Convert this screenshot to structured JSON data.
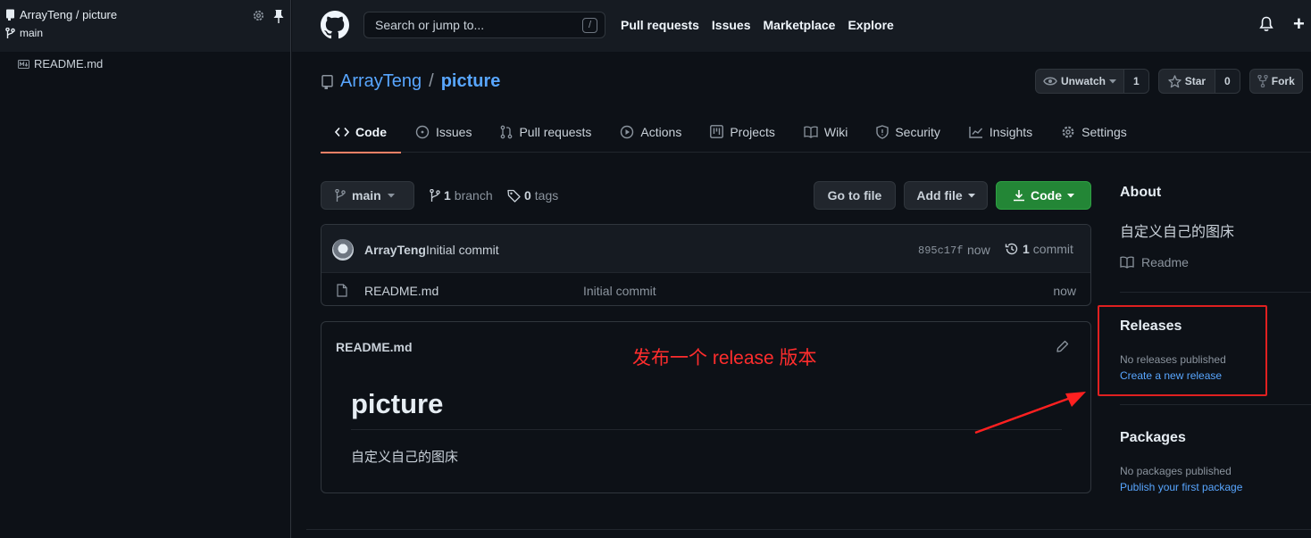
{
  "side": {
    "repo": "ArrayTeng / picture",
    "branch": "main",
    "files": [
      "README.md"
    ]
  },
  "header": {
    "search_placeholder": "Search or jump to...",
    "search_key": "/",
    "nav": [
      "Pull requests",
      "Issues",
      "Marketplace",
      "Explore"
    ],
    "new_label": "+"
  },
  "repo": {
    "owner": "ArrayTeng",
    "sep": "/",
    "name": "picture",
    "unwatch_label": "Unwatch",
    "unwatch_count": "1",
    "star_label": "Star",
    "star_count": "0",
    "fork_label": "Fork"
  },
  "tabs": [
    "Code",
    "Issues",
    "Pull requests",
    "Actions",
    "Projects",
    "Wiki",
    "Security",
    "Insights",
    "Settings"
  ],
  "toolbar": {
    "branch": "main",
    "branch_count": "1",
    "branch_word": "branch",
    "tag_count": "0",
    "tag_word": "tags",
    "go_to_file": "Go to file",
    "add_file": "Add file",
    "code": "Code"
  },
  "commit": {
    "author": "ArrayTeng",
    "message": "Initial commit",
    "sha": "895c17f",
    "when": "now",
    "count": "1",
    "count_word": "commit"
  },
  "files": [
    {
      "name": "README.md",
      "message": "Initial commit",
      "when": "now"
    }
  ],
  "readme": {
    "filename": "README.md",
    "heading": "picture",
    "body": "自定义自己的图床",
    "annotation": "发布一个 release 版本"
  },
  "sidebar": {
    "about_title": "About",
    "about_desc": "自定义自己的图床",
    "readme_link": "Readme",
    "releases_title": "Releases",
    "releases_none": "No releases published",
    "releases_link": "Create a new release",
    "packages_title": "Packages",
    "packages_none": "No packages published",
    "packages_link": "Publish your first package"
  },
  "colors": {
    "accent_link": "#58a6ff",
    "tab_underline": "#f78166",
    "code_button": "#238636",
    "annotation": "#ff2d2d"
  }
}
